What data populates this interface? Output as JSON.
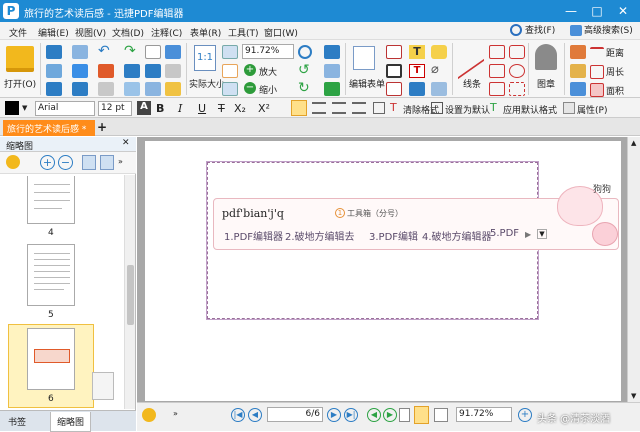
{
  "title_bar": {
    "app_icon": "P",
    "title": "旅行的艺术读后感 - 迅捷PDF编辑器",
    "minimize": "—",
    "maximize": "□",
    "close": "✕"
  },
  "menu": {
    "items": [
      "文件",
      "编辑(E)",
      "视图(V)",
      "文档(D)",
      "注释(C)",
      "表单(R)",
      "工具(T)",
      "窗口(W)"
    ],
    "search_label": "查找(F)",
    "advanced_search_label": "高级搜索(S)"
  },
  "ribbon": {
    "open_label": "打开(O)",
    "actual_size_label": "实际大小",
    "zoom_value": "91.72%",
    "zoom_in_label": "放大",
    "zoom_out_label": "缩小",
    "edit_form_label": "编辑表单",
    "line_label": "线条",
    "stamp_label": "图章",
    "distance_label": "距离",
    "perimeter_label": "周长",
    "area_label": "面积"
  },
  "format_bar": {
    "font_name": "Arial",
    "font_size": "12 pt",
    "bold": "B",
    "italic": "I",
    "underline": "U",
    "strike": "T",
    "subscript": "X₂",
    "superscript": "X²",
    "clear_format_label": "清除格式",
    "set_default_label": "设置为默认",
    "apply_default_label": "应用默认格式",
    "properties_label": "属性(P)"
  },
  "tabs": {
    "doc_tab_label": "旅行的艺术读后感 *",
    "add_tab": "+"
  },
  "thumbnails": {
    "panel_title": "缩略图",
    "pages": [
      {
        "label": "4"
      },
      {
        "label": "5"
      },
      {
        "label": "6"
      }
    ]
  },
  "side_tabs": {
    "bookmarks_label": "书签",
    "thumbnails_label": "缩略图"
  },
  "ime": {
    "pinyin": "pdf'bian'j'q",
    "hint_number": "1",
    "hint_label": "工具箱（分号）",
    "candidates": [
      "1.PDF编辑器",
      "2.破地方编辑去",
      "3.PDF编辑",
      "4.破地方编辑器",
      "5.PDF"
    ],
    "mascot_text": "狗狗"
  },
  "status_bar": {
    "page_field": "6",
    "page_total": "/6",
    "zoom_value": "91.72%"
  },
  "watermark": "头条 @清茶淡酒"
}
